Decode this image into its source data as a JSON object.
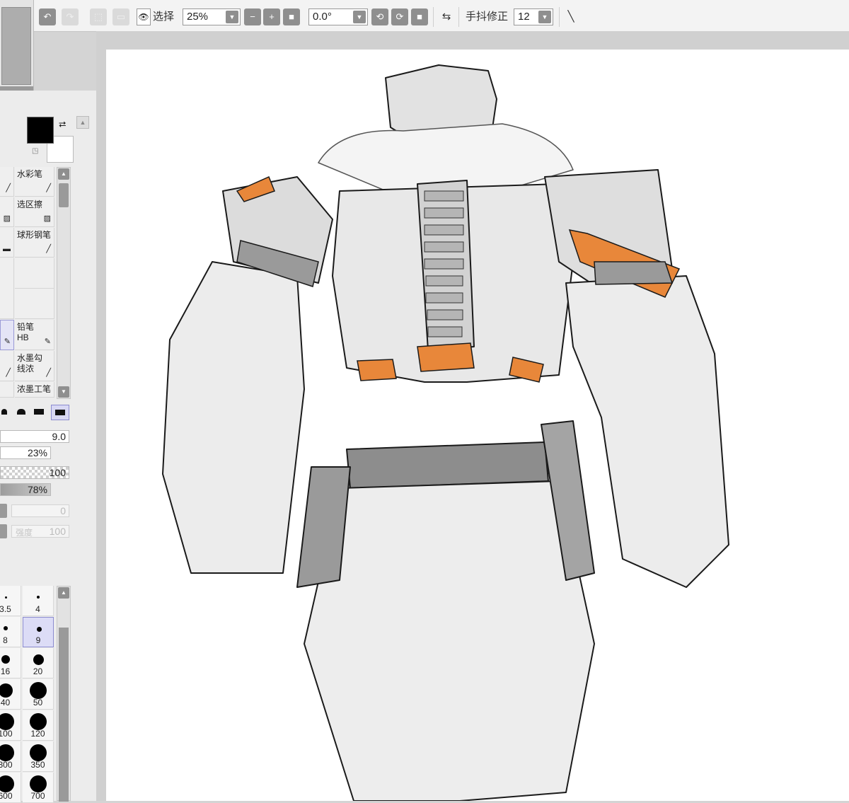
{
  "toolbar": {
    "select_label": "选择",
    "zoom_value": "25%",
    "rotation_value": "0.0°",
    "stabilizer_label": "手抖修正",
    "stabilizer_value": "12"
  },
  "tools": {
    "items": [
      {
        "label": "水彩笔",
        "sublabel": ""
      },
      {
        "label": "选区擦",
        "sublabel": ""
      },
      {
        "label": "球形钢笔",
        "sublabel": ""
      },
      {
        "label": "",
        "sublabel": ""
      },
      {
        "label": "铅笔",
        "sublabel": "HB"
      },
      {
        "label": "水墨勾",
        "sublabel": "线浓"
      },
      {
        "label": "浓墨工笔",
        "sublabel": ""
      }
    ]
  },
  "brush": {
    "size": "9.0",
    "min_size": "23%",
    "density": "100",
    "blend": "78%",
    "field_a": "0",
    "strength_label": "强度",
    "strength_value": "100"
  },
  "brush_sizes": [
    {
      "value": "3.5"
    },
    {
      "value": "4"
    },
    {
      "value": "8"
    },
    {
      "value": "9"
    },
    {
      "value": "16"
    },
    {
      "value": "20"
    },
    {
      "value": "40"
    },
    {
      "value": "50"
    },
    {
      "value": "100"
    },
    {
      "value": "120"
    },
    {
      "value": "300"
    },
    {
      "value": "350"
    },
    {
      "value": "600"
    },
    {
      "value": "700"
    }
  ],
  "selected_brush_size": "9",
  "colors": {
    "primary": "#000000",
    "accent_orange": "#e8873a"
  }
}
